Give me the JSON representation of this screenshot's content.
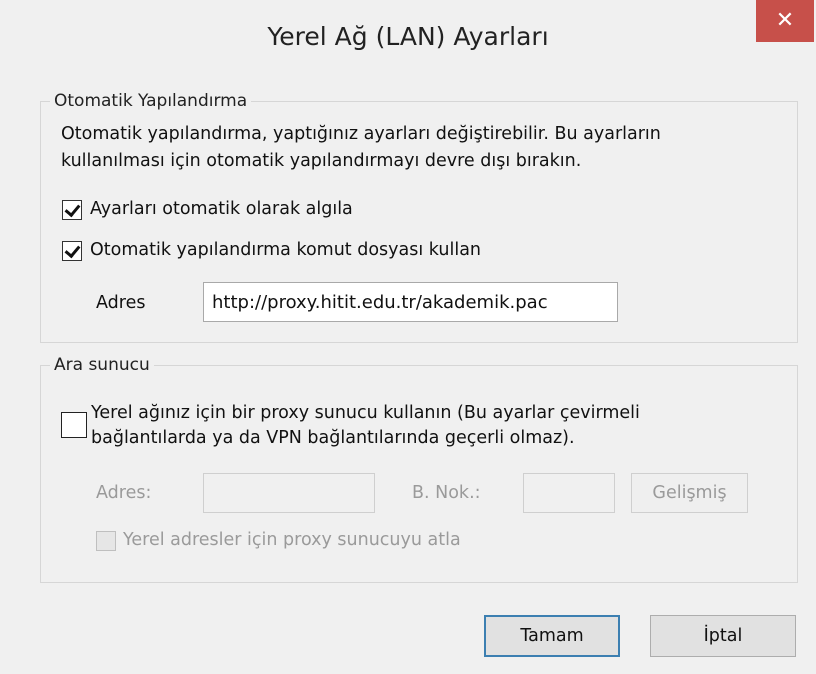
{
  "window": {
    "title": "Yerel Ağ (LAN) Ayarları",
    "close_label": "✕"
  },
  "auto_config": {
    "group_title": "Otomatik Yapılandırma",
    "description_line1": "Otomatik yapılandırma, yaptığınız ayarları değiştirebilir. Bu ayarların",
    "description_line2": "kullanılması için otomatik yapılandırmayı devre dışı bırakın.",
    "auto_detect_label": "Ayarları otomatik olarak algıla",
    "auto_detect_checked": true,
    "use_script_label": "Otomatik yapılandırma komut dosyası kullan",
    "use_script_checked": true,
    "address_label": "Adres",
    "address_value": "http://proxy.hitit.edu.tr/akademik.pac"
  },
  "proxy": {
    "group_title": "Ara sunucu",
    "use_proxy_line1": "Yerel ağınız için bir proxy sunucu kullanın (Bu ayarlar çevirmeli",
    "use_proxy_line2": "bağlantılarda ya da VPN bağlantılarında geçerli olmaz).",
    "use_proxy_checked": false,
    "address_label": "Adres:",
    "address_value": "",
    "port_label": "B. Nok.:",
    "port_value": "",
    "advanced_label": "Gelişmiş",
    "bypass_label": "Yerel adresler için proxy sunucuyu atla",
    "bypass_checked": false
  },
  "buttons": {
    "ok_label": "Tamam",
    "cancel_label": "İptal"
  },
  "colors": {
    "close_button": "#c7504a",
    "default_button_border": "#3c7fb1"
  }
}
